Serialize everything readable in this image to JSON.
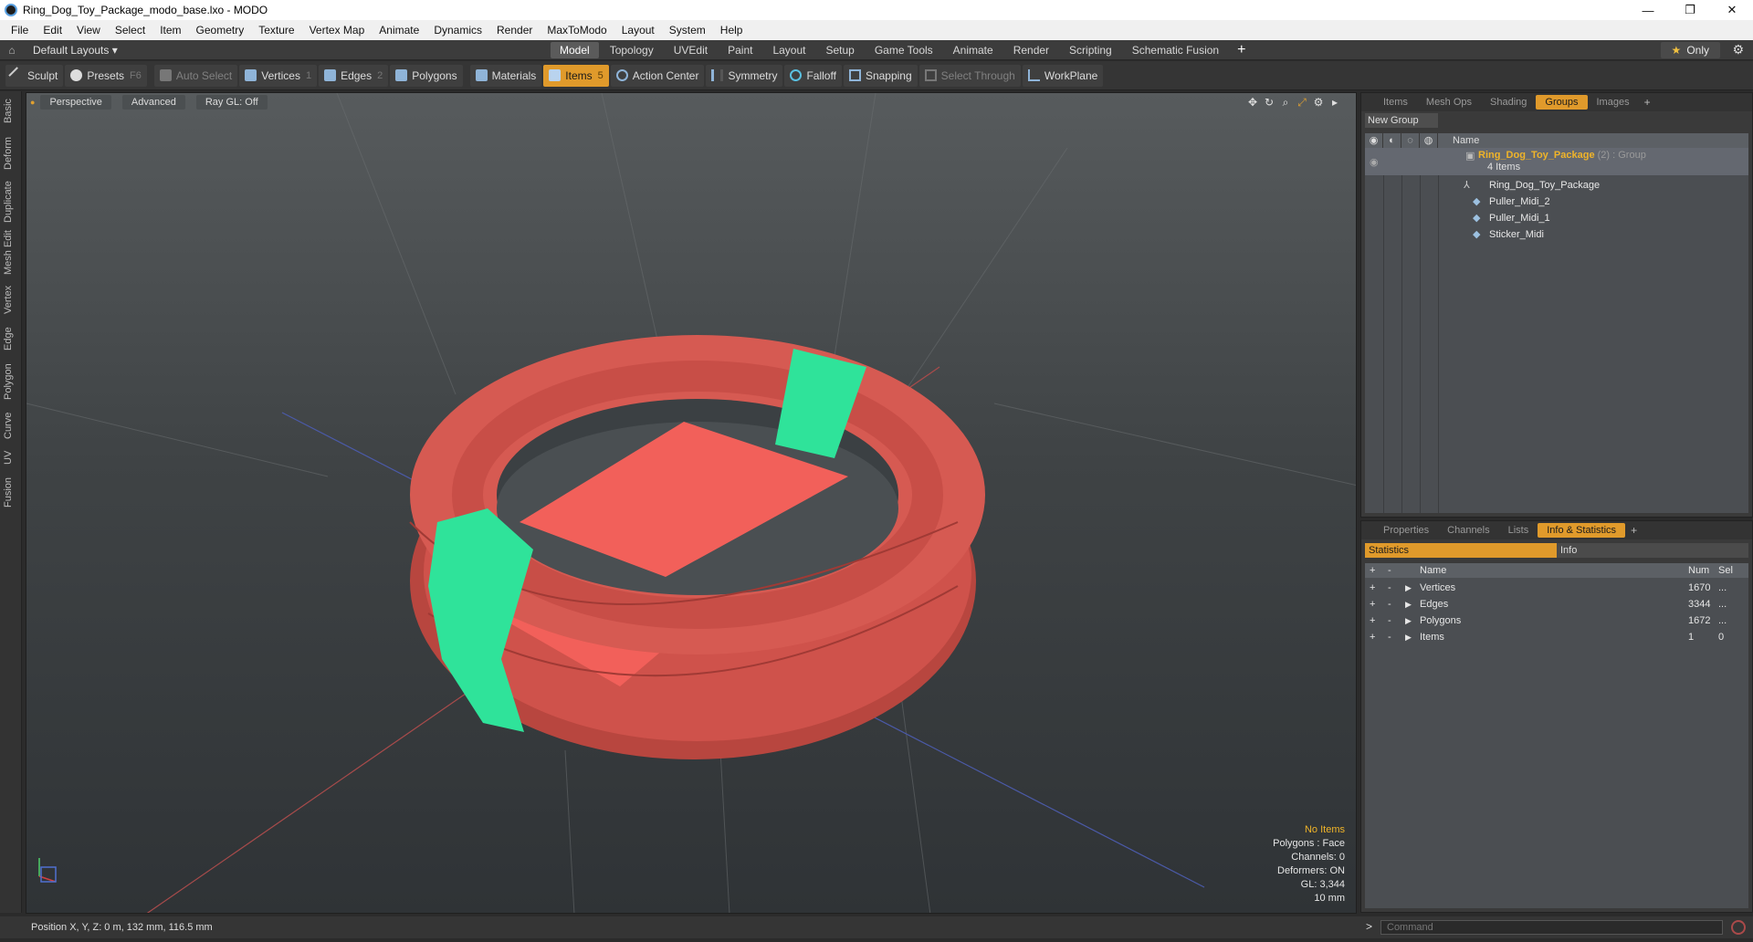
{
  "window": {
    "title": "Ring_Dog_Toy_Package_modo_base.lxo - MODO",
    "minimize": "—",
    "maximize": "❐",
    "close": "✕"
  },
  "menu": [
    "File",
    "Edit",
    "View",
    "Select",
    "Item",
    "Geometry",
    "Texture",
    "Vertex Map",
    "Animate",
    "Dynamics",
    "Render",
    "MaxToModo",
    "Layout",
    "System",
    "Help"
  ],
  "layoutbar": {
    "layouts_label": "Default Layouts ▾",
    "tabs": [
      "Model",
      "Topology",
      "UVEdit",
      "Paint",
      "Layout",
      "Setup",
      "Game Tools",
      "Animate",
      "Render",
      "Scripting",
      "Schematic Fusion"
    ],
    "active_tab": "Model",
    "plus": "+",
    "only_star": "★",
    "only_label": "Only"
  },
  "toolbar": {
    "sculpt": "Sculpt",
    "presets": "Presets",
    "presets_key": "F6",
    "auto_select": "Auto Select",
    "vertices": "Vertices",
    "vertices_key": "1",
    "edges": "Edges",
    "edges_key": "2",
    "polygons": "Polygons",
    "materials": "Materials",
    "items": "Items",
    "items_key": "5",
    "action_center": "Action Center",
    "symmetry": "Symmetry",
    "falloff": "Falloff",
    "snapping": "Snapping",
    "select_through": "Select Through",
    "workplane": "WorkPlane"
  },
  "left_tabs": [
    "Basic",
    "Deform",
    "Duplicate",
    "Mesh Edit",
    "Vertex",
    "Edge",
    "Polygon",
    "Curve",
    "UV",
    "Fusion"
  ],
  "viewport": {
    "perspective": "Perspective",
    "advanced": "Advanced",
    "raygl": "Ray GL: Off",
    "stats": {
      "no_items": "No Items",
      "polygons": "Polygons : Face",
      "channels": "Channels: 0",
      "deformers": "Deformers: ON",
      "gl": "GL: 3,344",
      "scale": "10 mm"
    }
  },
  "status": {
    "position": "Position X, Y, Z:  0 m, 132 mm, 116.5 mm"
  },
  "groups_panel": {
    "tabs": [
      "Items",
      "Mesh Ops",
      "Shading",
      "Groups",
      "Images"
    ],
    "active": "Groups",
    "new_group": "New Group",
    "name_header": "Name",
    "group": {
      "name": "Ring_Dog_Toy_Package",
      "meta": "(2) : Group",
      "count": "4 Items"
    },
    "children": [
      "Ring_Dog_Toy_Package",
      "Puller_Midi_2",
      "Puller_Midi_1",
      "Sticker_Midi"
    ]
  },
  "info_panel": {
    "tabs": [
      "Properties",
      "Channels",
      "Lists",
      "Info & Statistics"
    ],
    "active": "Info & Statistics",
    "sub_statistics": "Statistics",
    "sub_info": "Info",
    "headers": {
      "name": "Name",
      "num": "Num",
      "sel": "Sel"
    },
    "rows": [
      {
        "name": "Vertices",
        "num": "1670",
        "sel": "..."
      },
      {
        "name": "Edges",
        "num": "3344",
        "sel": "..."
      },
      {
        "name": "Polygons",
        "num": "1672",
        "sel": "..."
      },
      {
        "name": "Items",
        "num": "1",
        "sel": "0"
      }
    ]
  },
  "command": {
    "prompt": ">",
    "placeholder": "Command"
  },
  "colors": {
    "accent": "#e09a2b",
    "ring": "#d9544e",
    "sticker": "#2fe39a"
  }
}
